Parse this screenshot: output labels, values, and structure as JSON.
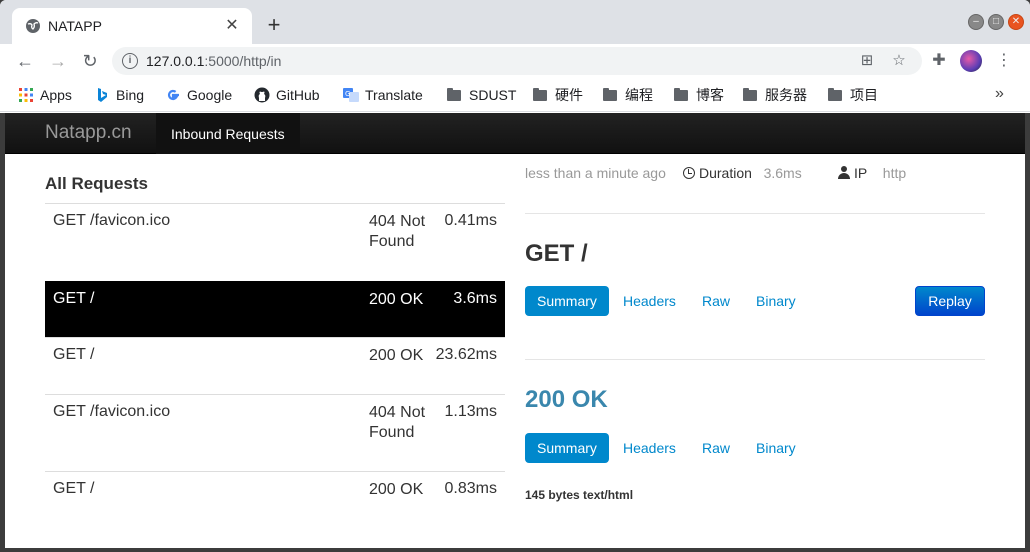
{
  "browser": {
    "tab_title": "NATAPP",
    "url_host": "127.0.0.1",
    "url_rest": ":5000/http/in",
    "bookmarks": [
      "Apps",
      "Bing",
      "Google",
      "GitHub",
      "Translate",
      "SDUST",
      "硬件",
      "编程",
      "博客",
      "服务器",
      "项目"
    ],
    "more": "»"
  },
  "app": {
    "brand": "Natapp.cn",
    "nav_tab": "Inbound Requests"
  },
  "left": {
    "title": "All Requests",
    "requests": [
      {
        "path": "GET /favicon.ico",
        "status": "404 Not Found",
        "duration": "0.41ms"
      },
      {
        "path": "GET /",
        "status": "200 OK",
        "duration": "3.6ms"
      },
      {
        "path": "GET /",
        "status": "200 OK",
        "duration": "23.62ms"
      },
      {
        "path": "GET /favicon.ico",
        "status": "404 Not Found",
        "duration": "1.13ms"
      },
      {
        "path": "GET /",
        "status": "200 OK",
        "duration": "0.83ms"
      }
    ]
  },
  "detail": {
    "time": "less than a minute ago",
    "duration_label": "Duration",
    "duration_value": "3.6ms",
    "ip_label": "IP",
    "ip_value": "http",
    "request_title": "GET /",
    "request_tabs": [
      "Summary",
      "Headers",
      "Raw",
      "Binary"
    ],
    "replay_label": "Replay",
    "response_title": "200 OK",
    "response_tabs": [
      "Summary",
      "Headers",
      "Raw",
      "Binary"
    ],
    "response_summary": "145 bytes text/html"
  }
}
